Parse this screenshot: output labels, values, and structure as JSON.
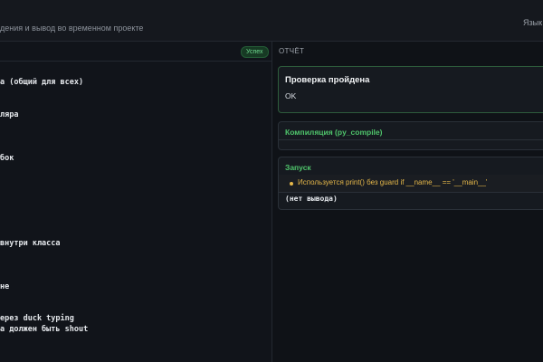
{
  "header": {
    "subtitle": "дения и вывод во временном проекте",
    "language_label": "Язык"
  },
  "editor": {
    "status_badge": "Успех",
    "lines": [
      "а (общий для всех)",
      "ляра",
      "бок",
      " внутри класса",
      "не",
      "ерез duck typing",
      "а должен быть shout"
    ]
  },
  "report": {
    "header_label": "ОТЧЁТ",
    "pass_card": {
      "title": "Проверка пройдена",
      "body": "OK"
    },
    "compile_card": {
      "title": "Компиляция (py_compile)"
    },
    "run_card": {
      "title": "Запуск",
      "warning": "Используется print() без guard if __name__ == '__main__'",
      "output": "(нет вывода)"
    }
  },
  "colors": {
    "success": "#4fc46b",
    "warning": "#e6b84a"
  }
}
